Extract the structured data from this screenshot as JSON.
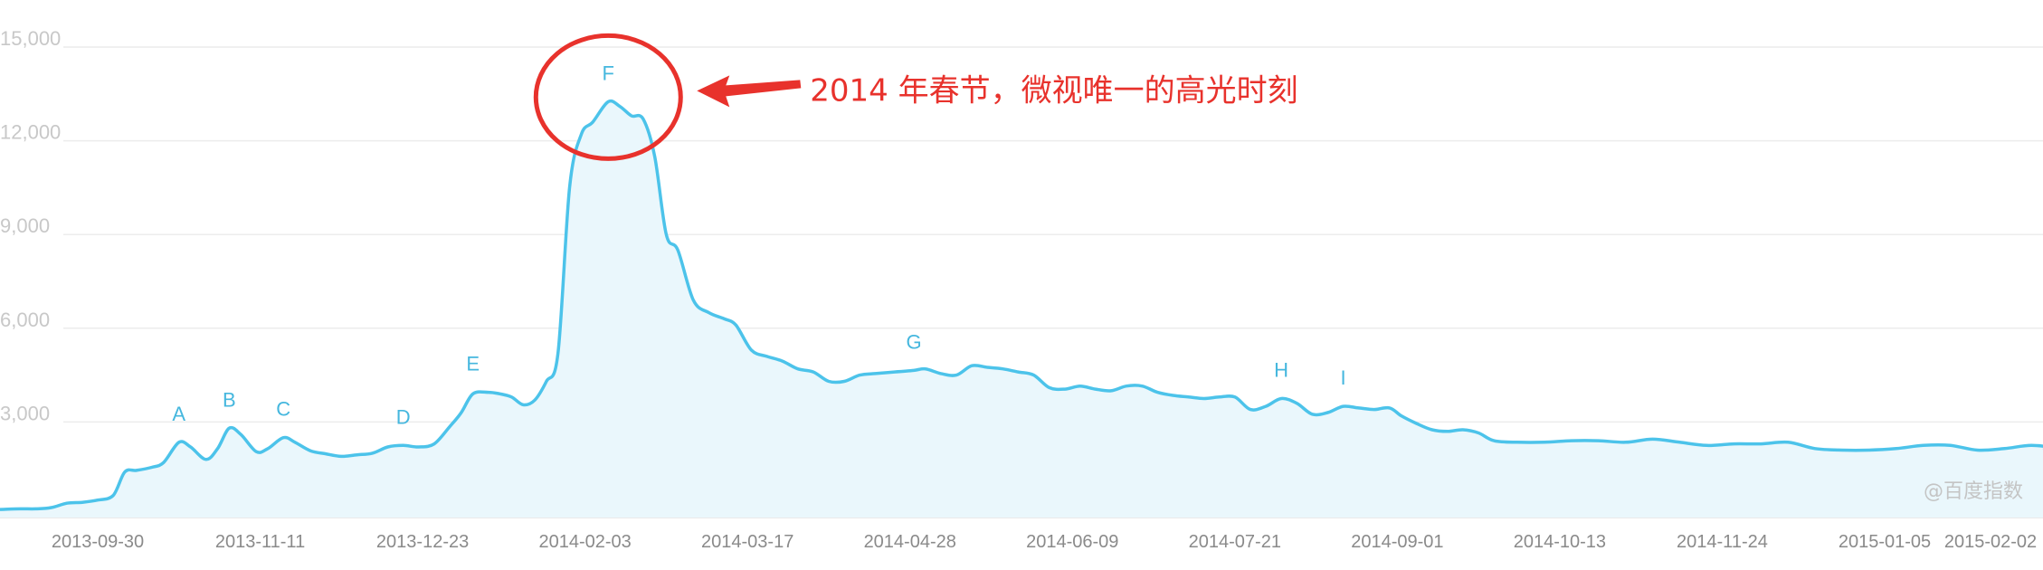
{
  "chart_data": {
    "type": "area",
    "title": "",
    "xlabel": "",
    "ylabel": "",
    "ylim": [
      0,
      15000
    ],
    "grid": true,
    "legend": "none",
    "y_ticks": [
      "15,000",
      "12,000",
      "9,000",
      "6,000",
      "3,000"
    ],
    "y_tick_values": [
      15000,
      12000,
      9000,
      6000,
      3000
    ],
    "x_ticks": [
      {
        "label": "2013-09-30",
        "date": "2013-09-30"
      },
      {
        "label": "2013-11-11",
        "date": "2013-11-11"
      },
      {
        "label": "2013-12-23",
        "date": "2013-12-23"
      },
      {
        "label": "2014-02-03",
        "date": "2014-02-03"
      },
      {
        "label": "2014-03-17",
        "date": "2014-03-17"
      },
      {
        "label": "2014-04-28",
        "date": "2014-04-28"
      },
      {
        "label": "2014-06-09",
        "date": "2014-06-09"
      },
      {
        "label": "2014-07-21",
        "date": "2014-07-21"
      },
      {
        "label": "2014-09-01",
        "date": "2014-09-01"
      },
      {
        "label": "2014-10-13",
        "date": "2014-10-13"
      },
      {
        "label": "2014-11-24",
        "date": "2014-11-24"
      },
      {
        "label": "2015-01-05",
        "date": "2015-01-05"
      },
      {
        "label": "2015-02-02",
        "date": "2015-02-02"
      }
    ],
    "series": [
      {
        "color": "#4cc3ea",
        "fill": "#eaf7fc",
        "points": [
          [
            "2013-09-06",
            200
          ],
          [
            "2013-09-10",
            220
          ],
          [
            "2013-09-14",
            220
          ],
          [
            "2013-09-18",
            260
          ],
          [
            "2013-09-22",
            400
          ],
          [
            "2013-09-26",
            430
          ],
          [
            "2013-09-30",
            500
          ],
          [
            "2013-10-04",
            650
          ],
          [
            "2013-10-07",
            1400
          ],
          [
            "2013-10-10",
            1450
          ],
          [
            "2013-10-14",
            1550
          ],
          [
            "2013-10-17",
            1700
          ],
          [
            "2013-10-21",
            2350
          ],
          [
            "2013-10-24",
            2200
          ],
          [
            "2013-10-28",
            1800
          ],
          [
            "2013-10-31",
            2150
          ],
          [
            "2013-11-03",
            2800
          ],
          [
            "2013-11-06",
            2600
          ],
          [
            "2013-11-10",
            2050
          ],
          [
            "2013-11-13",
            2150
          ],
          [
            "2013-11-17",
            2500
          ],
          [
            "2013-11-20",
            2350
          ],
          [
            "2013-11-24",
            2080
          ],
          [
            "2013-11-28",
            1980
          ],
          [
            "2013-12-02",
            1900
          ],
          [
            "2013-12-06",
            1950
          ],
          [
            "2013-12-10",
            2000
          ],
          [
            "2013-12-14",
            2200
          ],
          [
            "2013-12-18",
            2250
          ],
          [
            "2013-12-22",
            2200
          ],
          [
            "2013-12-26",
            2300
          ],
          [
            "2013-12-30",
            2850
          ],
          [
            "2014-01-02",
            3300
          ],
          [
            "2014-01-05",
            3900
          ],
          [
            "2014-01-09",
            3950
          ],
          [
            "2014-01-12",
            3900
          ],
          [
            "2014-01-15",
            3800
          ],
          [
            "2014-01-18",
            3550
          ],
          [
            "2014-01-21",
            3700
          ],
          [
            "2014-01-24",
            4300
          ],
          [
            "2014-01-27",
            5200
          ],
          [
            "2014-01-30",
            10500
          ],
          [
            "2014-02-02",
            12200
          ],
          [
            "2014-02-05",
            12600
          ],
          [
            "2014-02-09",
            13250
          ],
          [
            "2014-02-12",
            13100
          ],
          [
            "2014-02-15",
            12800
          ],
          [
            "2014-02-18",
            12700
          ],
          [
            "2014-02-21",
            11500
          ],
          [
            "2014-02-24",
            9000
          ],
          [
            "2014-02-27",
            8500
          ],
          [
            "2014-03-03",
            6900
          ],
          [
            "2014-03-07",
            6500
          ],
          [
            "2014-03-11",
            6300
          ],
          [
            "2014-03-14",
            6100
          ],
          [
            "2014-03-18",
            5300
          ],
          [
            "2014-03-22",
            5100
          ],
          [
            "2014-03-26",
            4950
          ],
          [
            "2014-03-30",
            4700
          ],
          [
            "2014-04-03",
            4600
          ],
          [
            "2014-04-07",
            4300
          ],
          [
            "2014-04-11",
            4300
          ],
          [
            "2014-04-15",
            4500
          ],
          [
            "2014-04-19",
            4550
          ],
          [
            "2014-04-24",
            4600
          ],
          [
            "2014-04-29",
            4650
          ],
          [
            "2014-05-02",
            4700
          ],
          [
            "2014-05-06",
            4550
          ],
          [
            "2014-05-10",
            4500
          ],
          [
            "2014-05-14",
            4800
          ],
          [
            "2014-05-18",
            4750
          ],
          [
            "2014-05-22",
            4700
          ],
          [
            "2014-05-26",
            4600
          ],
          [
            "2014-05-30",
            4500
          ],
          [
            "2014-06-03",
            4100
          ],
          [
            "2014-06-07",
            4050
          ],
          [
            "2014-06-11",
            4150
          ],
          [
            "2014-06-15",
            4050
          ],
          [
            "2014-06-19",
            4000
          ],
          [
            "2014-06-23",
            4150
          ],
          [
            "2014-06-27",
            4150
          ],
          [
            "2014-07-01",
            3950
          ],
          [
            "2014-07-05",
            3850
          ],
          [
            "2014-07-09",
            3800
          ],
          [
            "2014-07-13",
            3750
          ],
          [
            "2014-07-17",
            3800
          ],
          [
            "2014-07-21",
            3800
          ],
          [
            "2014-07-25",
            3400
          ],
          [
            "2014-07-29",
            3500
          ],
          [
            "2014-08-02",
            3750
          ],
          [
            "2014-08-06",
            3600
          ],
          [
            "2014-08-10",
            3250
          ],
          [
            "2014-08-14",
            3300
          ],
          [
            "2014-08-18",
            3500
          ],
          [
            "2014-08-22",
            3450
          ],
          [
            "2014-08-26",
            3400
          ],
          [
            "2014-08-30",
            3450
          ],
          [
            "2014-09-02",
            3200
          ],
          [
            "2014-09-06",
            2950
          ],
          [
            "2014-09-10",
            2750
          ],
          [
            "2014-09-14",
            2700
          ],
          [
            "2014-09-18",
            2750
          ],
          [
            "2014-09-22",
            2650
          ],
          [
            "2014-09-26",
            2400
          ],
          [
            "2014-10-02",
            2350
          ],
          [
            "2014-10-09",
            2350
          ],
          [
            "2014-10-16",
            2400
          ],
          [
            "2014-10-23",
            2400
          ],
          [
            "2014-10-30",
            2350
          ],
          [
            "2014-11-06",
            2450
          ],
          [
            "2014-11-13",
            2350
          ],
          [
            "2014-11-20",
            2250
          ],
          [
            "2014-11-27",
            2300
          ],
          [
            "2014-12-04",
            2300
          ],
          [
            "2014-12-11",
            2350
          ],
          [
            "2014-12-18",
            2150
          ],
          [
            "2014-12-25",
            2100
          ],
          [
            "2015-01-01",
            2100
          ],
          [
            "2015-01-08",
            2150
          ],
          [
            "2015-01-15",
            2250
          ],
          [
            "2015-01-22",
            2250
          ],
          [
            "2015-01-29",
            2100
          ],
          [
            "2015-02-05",
            2150
          ],
          [
            "2015-02-12",
            2250
          ],
          [
            "2015-02-19",
            2150
          ],
          [
            "2015-02-26",
            2100
          ]
        ]
      }
    ],
    "markers": [
      {
        "label": "A",
        "date": "2013-10-21",
        "value": 2350
      },
      {
        "label": "B",
        "date": "2013-11-03",
        "value": 2800
      },
      {
        "label": "C",
        "date": "2013-11-17",
        "value": 2500
      },
      {
        "label": "D",
        "date": "2013-12-18",
        "value": 2250
      },
      {
        "label": "E",
        "date": "2014-01-05",
        "value": 3950
      },
      {
        "label": "F",
        "date": "2014-02-09",
        "value": 13250
      },
      {
        "label": "G",
        "date": "2014-04-29",
        "value": 4650
      },
      {
        "label": "H",
        "date": "2014-08-02",
        "value": 3750
      },
      {
        "label": "I",
        "date": "2014-08-18",
        "value": 3500
      }
    ],
    "annotation": {
      "text": "2014 年春节，微视唯一的高光时刻",
      "target": "F",
      "color": "#e8322c"
    },
    "watermark": "@百度指数"
  }
}
